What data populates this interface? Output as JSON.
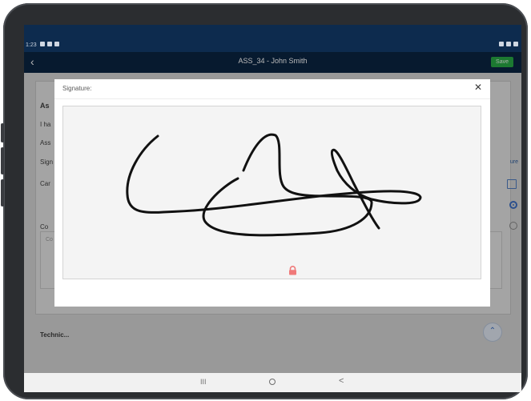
{
  "status_bar": {
    "time": "1:23"
  },
  "app_bar": {
    "title": "ASS_34 - John Smith",
    "save_label": "Save"
  },
  "background": {
    "rows": [
      "As",
      "I ha",
      "Ass",
      "Sign",
      "Car",
      "Co",
      "Co"
    ],
    "right_link": "ure",
    "bottom_heading": "Technic...",
    "scroll_up_icon": "chevron-up-icon"
  },
  "modal": {
    "title": "Signature:",
    "close_icon": "close-icon",
    "lock_icon": "lock-icon"
  },
  "nav": {
    "recent_label": "III",
    "back_label": "<"
  },
  "colors": {
    "status_bar": "#0d2b4e",
    "app_bar": "#0b2442",
    "save_button": "#27a844",
    "lock": "#f07a7a"
  }
}
